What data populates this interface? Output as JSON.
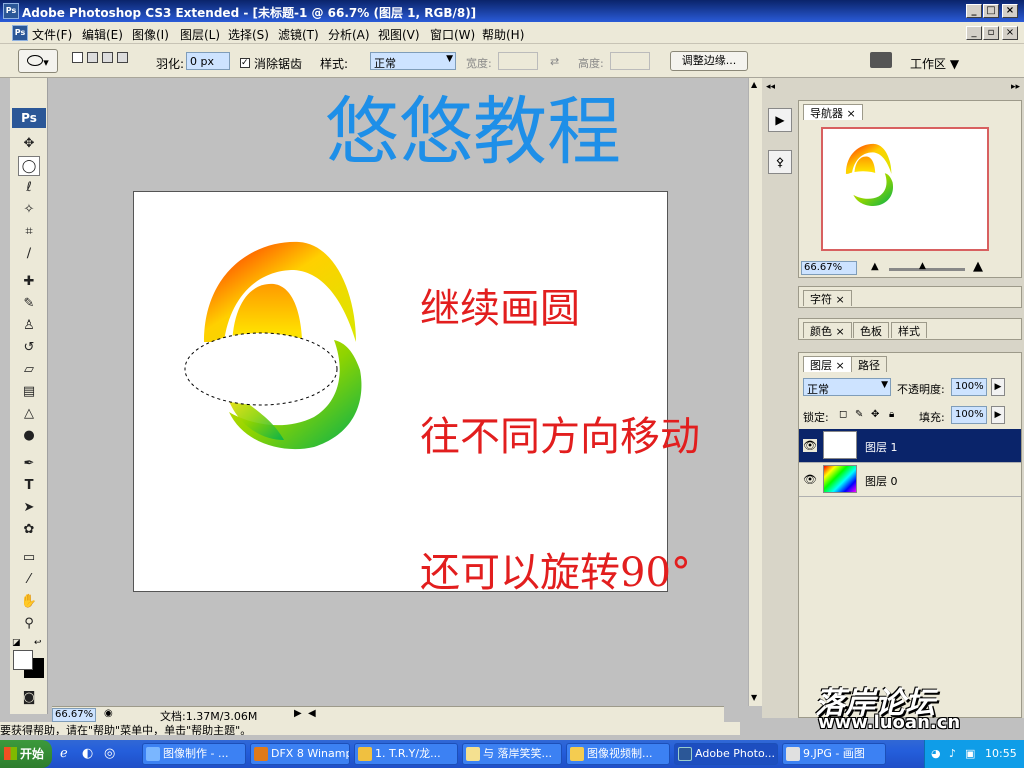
{
  "window": {
    "title": "Adobe Photoshop CS3 Extended - [未标题-1 @ 66.7% (图层 1, RGB/8)]",
    "app_icon": "Ps"
  },
  "menu": [
    "文件(F)",
    "编辑(E)",
    "图像(I)",
    "图层(L)",
    "选择(S)",
    "滤镜(T)",
    "分析(A)",
    "视图(V)",
    "窗口(W)",
    "帮助(H)"
  ],
  "options": {
    "feather_label": "羽化:",
    "feather_value": "0 px",
    "antialias_label": "消除锯齿",
    "antialias_checked": true,
    "style_label": "样式:",
    "style_value": "正常",
    "width_label": "宽度:",
    "height_label": "高度:",
    "refine_button": "调整边缘...",
    "workspace_button": "工作区 ▼"
  },
  "toolbox": {
    "logo": "Ps"
  },
  "document": {
    "title_text": "悠悠教程",
    "line1": "继续画圆",
    "line2": "往不同方向移动",
    "line3": "还可以旋转90°"
  },
  "status": {
    "zoom": "66.67%",
    "doc_info": "文档:1.37M/3.06M"
  },
  "hint": "要获得帮助，请在\"帮助\"菜单中，单击\"帮助主题\"。",
  "navigator": {
    "tab": "导航器",
    "zoom": "66.67%"
  },
  "character": {
    "tab": "字符"
  },
  "color_panel": {
    "tabs": [
      "颜色",
      "色板",
      "样式"
    ]
  },
  "layers_panel": {
    "tabs": [
      "图层",
      "路径"
    ],
    "blend_mode": "正常",
    "opacity_label": "不透明度:",
    "opacity_value": "100%",
    "lock_label": "锁定:",
    "fill_label": "填充:",
    "fill_value": "100%",
    "layers": [
      {
        "name": "图层 1",
        "selected": true
      },
      {
        "name": "图层 0",
        "selected": false
      }
    ]
  },
  "taskbar": {
    "start": "开始",
    "tasks": [
      "图像制作 - ...",
      "DFX 8 Winamp",
      "1. T.R.Y/龙...",
      "与 落岸笑笑...",
      "图像视频制...",
      "Adobe Photo...",
      "9.JPG - 画图"
    ],
    "clock": "10:55"
  },
  "watermark": {
    "site": "落岸论坛",
    "url": "www.luoan.cn"
  }
}
